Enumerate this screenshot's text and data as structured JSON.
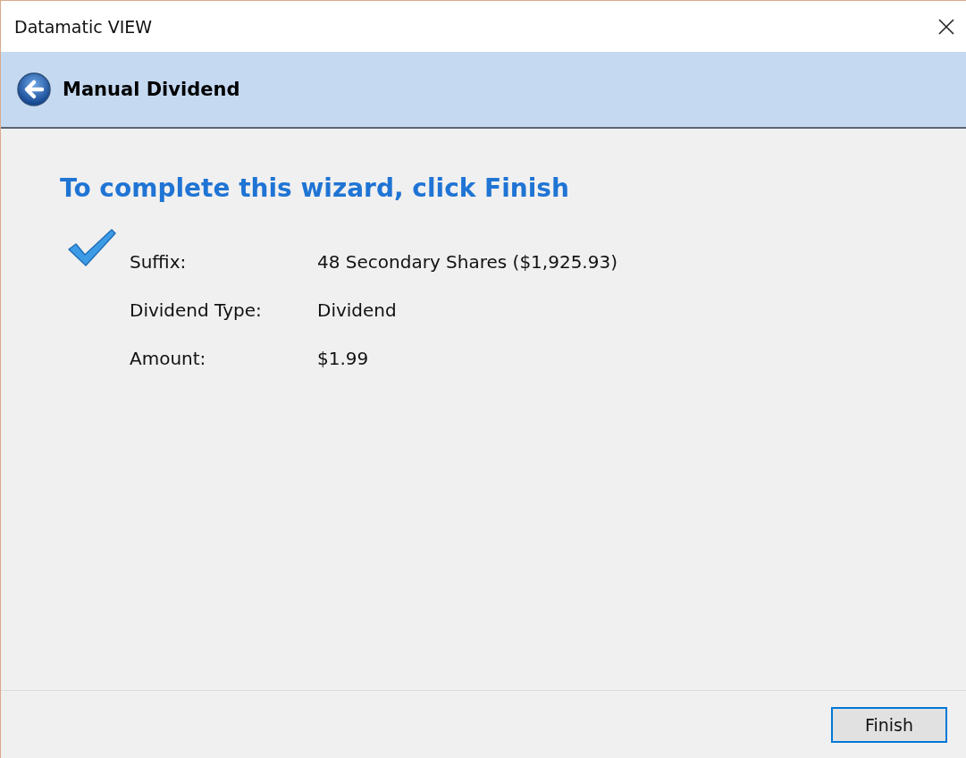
{
  "window": {
    "title": "Datamatic VIEW"
  },
  "header": {
    "title": "Manual Dividend"
  },
  "heading": "To complete this wizard, click Finish",
  "summary": [
    {
      "label": "Suffix:",
      "value": "48 Secondary Shares ($1,925.93)"
    },
    {
      "label": "Dividend Type:",
      "value": "Dividend"
    },
    {
      "label": "Amount:",
      "value": "$1.99"
    }
  ],
  "buttons": [
    {
      "label": "Finish",
      "focused": true
    }
  ]
}
